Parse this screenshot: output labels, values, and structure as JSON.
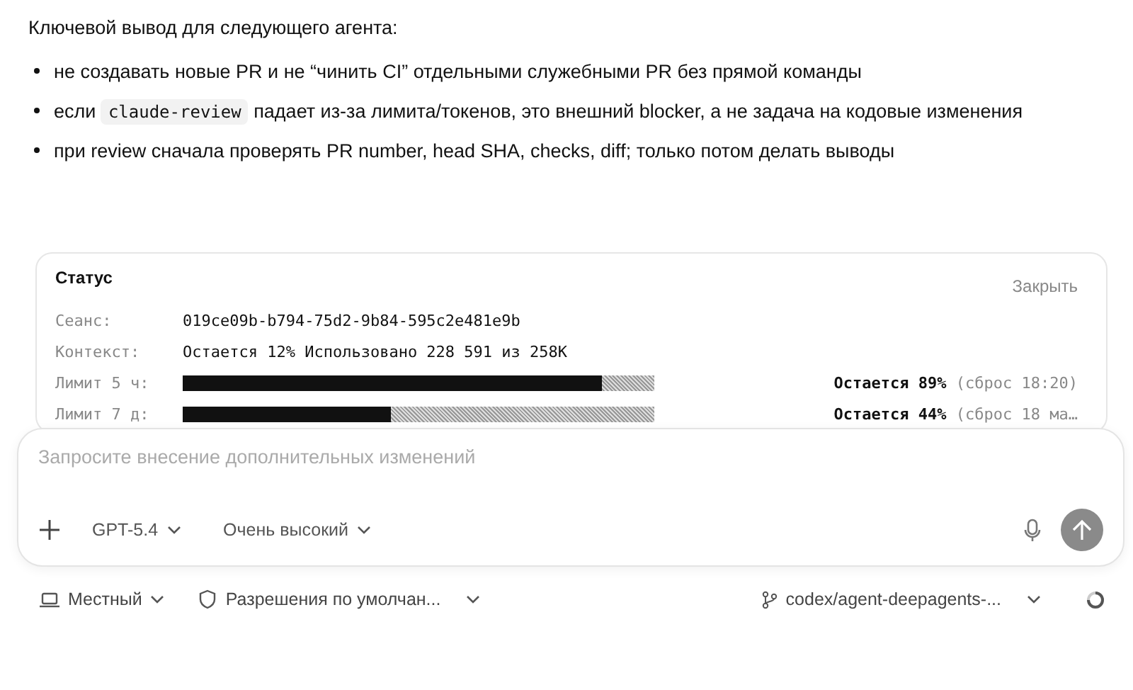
{
  "heading": "Ключевой вывод для следующего агента:",
  "bullets": [
    {
      "kind": "text",
      "text": "не создавать новые PR и не “чинить CI” отдельными служебными PR без прямой команды"
    },
    {
      "kind": "code",
      "before": "если",
      "code": "claude-review",
      "after": "падает из-за лимита/токенов, это внешний blocker, а не задача на кодовые изменения"
    },
    {
      "kind": "text",
      "text": "при review сначала проверять PR number, head SHA, checks, diff; только потом делать выводы"
    }
  ],
  "status": {
    "title": "Статус",
    "close": "Закрыть",
    "fields": [
      {
        "label": "Сеанс:",
        "value": "019ce09b-b794-75d2-9b84-595c2e481e9b"
      },
      {
        "label": "Контекст:",
        "value": "Остается 12% Использовано 228 591 из 258K"
      }
    ],
    "limits": [
      {
        "label": "Лимит 5 ч:",
        "level": 0.89,
        "reading": "**Остается 89%** (сброс 18:20)"
      },
      {
        "label": "Лимит 7 д:",
        "level": 0.44,
        "reading": "**Остается 44%** (сброс 18 ма…"
      }
    ]
  },
  "composer": {
    "placeholder": "Запросите внесение дополнительных изменений",
    "model": "GPT-5.4",
    "effort": "Очень высокий"
  },
  "footer": {
    "environment": "Местный",
    "permissions": "Разрешения по умолчан...",
    "branch": "codex/agent-deepagents-..."
  }
}
